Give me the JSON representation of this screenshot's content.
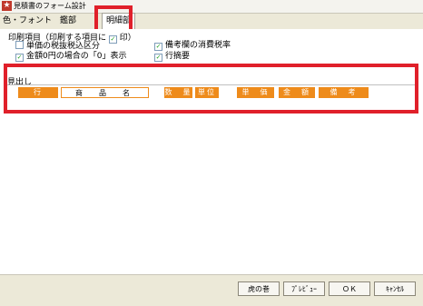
{
  "window": {
    "title": "見積書のフォーム設計"
  },
  "tabs": {
    "color_font": "色・フォント",
    "invoice": "鑑部",
    "detail": "明細部"
  },
  "print_items": {
    "label_before": "印刷項目（印刷する項目に",
    "check": "✓",
    "label_after": "印）",
    "options": [
      {
        "label": "単価の税抜税込区分",
        "checked": false
      },
      {
        "label": "金額0円の場合の「0」表示",
        "checked": true
      },
      {
        "label": "備考欄の消費税率",
        "checked": true
      },
      {
        "label": "行摘要",
        "checked": true
      }
    ]
  },
  "midashi": {
    "label": "見出し",
    "headers": [
      "行",
      "商　品　名",
      "数　量",
      "単位",
      "単　価",
      "金　額",
      "備　考"
    ]
  },
  "buttons": {
    "tora": "虎の巻",
    "preview": "ﾌﾟﾚﾋﾞｭｰ",
    "ok": "ＯＫ",
    "cancel": "ｷｬﾝｾﾙ"
  },
  "colors": {
    "header_orange": "#ee8b1b",
    "highlight_red": "#e0202a"
  }
}
